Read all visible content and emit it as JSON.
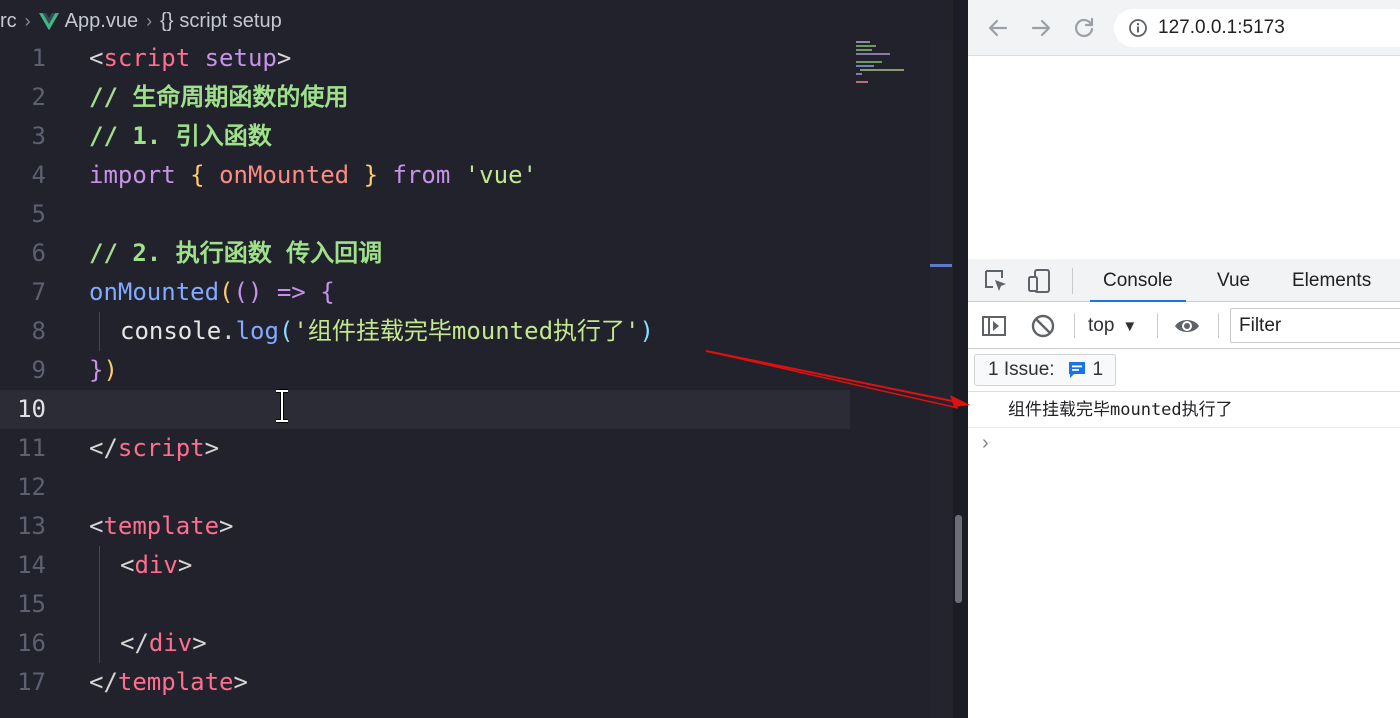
{
  "editor": {
    "breadcrumb": {
      "folder": "rc",
      "file": "App.vue",
      "symbol": "script setup",
      "symbol_icon": "{}"
    },
    "current_line": 10,
    "lines": [
      {
        "n": "1"
      },
      {
        "n": "2"
      },
      {
        "n": "3"
      },
      {
        "n": "4"
      },
      {
        "n": "5"
      },
      {
        "n": "6"
      },
      {
        "n": "7"
      },
      {
        "n": "8"
      },
      {
        "n": "9"
      },
      {
        "n": "10"
      },
      {
        "n": "11"
      },
      {
        "n": "12"
      },
      {
        "n": "13"
      },
      {
        "n": "14"
      },
      {
        "n": "15"
      },
      {
        "n": "16"
      },
      {
        "n": "17"
      }
    ],
    "code": {
      "l1_tag": "script",
      "l1_attr": "setup",
      "l2_comment": "// 生命周期函数的使用",
      "l3_comment": "// 1. 引入函数",
      "l4_import": "import",
      "l4_name": "onMounted",
      "l4_from": "from",
      "l4_module": "'vue'",
      "l6_comment": "// 2. 执行函数 传入回调",
      "l7_fn": "onMounted",
      "l7_arrow": "=>",
      "l8_obj": "console",
      "l8_method": "log",
      "l8_str": "'组件挂载完毕mounted执行了'",
      "l11_tag": "script",
      "l13_tag": "template",
      "l14_tag": "div",
      "l16_tag": "div",
      "l17_tag": "template"
    },
    "colors": {
      "tag": "#ff6e8e",
      "comment": "#9fe08a",
      "keyword": "#c792ea",
      "string": "#c3e88d",
      "function": "#82aaff"
    }
  },
  "browser": {
    "url": "127.0.0.1:5173",
    "nav_icons": [
      "back-arrow-icon",
      "forward-arrow-icon",
      "reload-icon",
      "info-icon"
    ]
  },
  "devtools": {
    "tabs": [
      {
        "label": "Console",
        "active": true
      },
      {
        "label": "Vue",
        "active": false
      },
      {
        "label": "Elements",
        "active": false
      }
    ],
    "context": "top",
    "filter_placeholder": "Filter",
    "issues_label": "1 Issue:",
    "issues_count": "1",
    "console_output": "组件挂载完毕mounted执行了",
    "accent_color": "#1a73e8"
  }
}
